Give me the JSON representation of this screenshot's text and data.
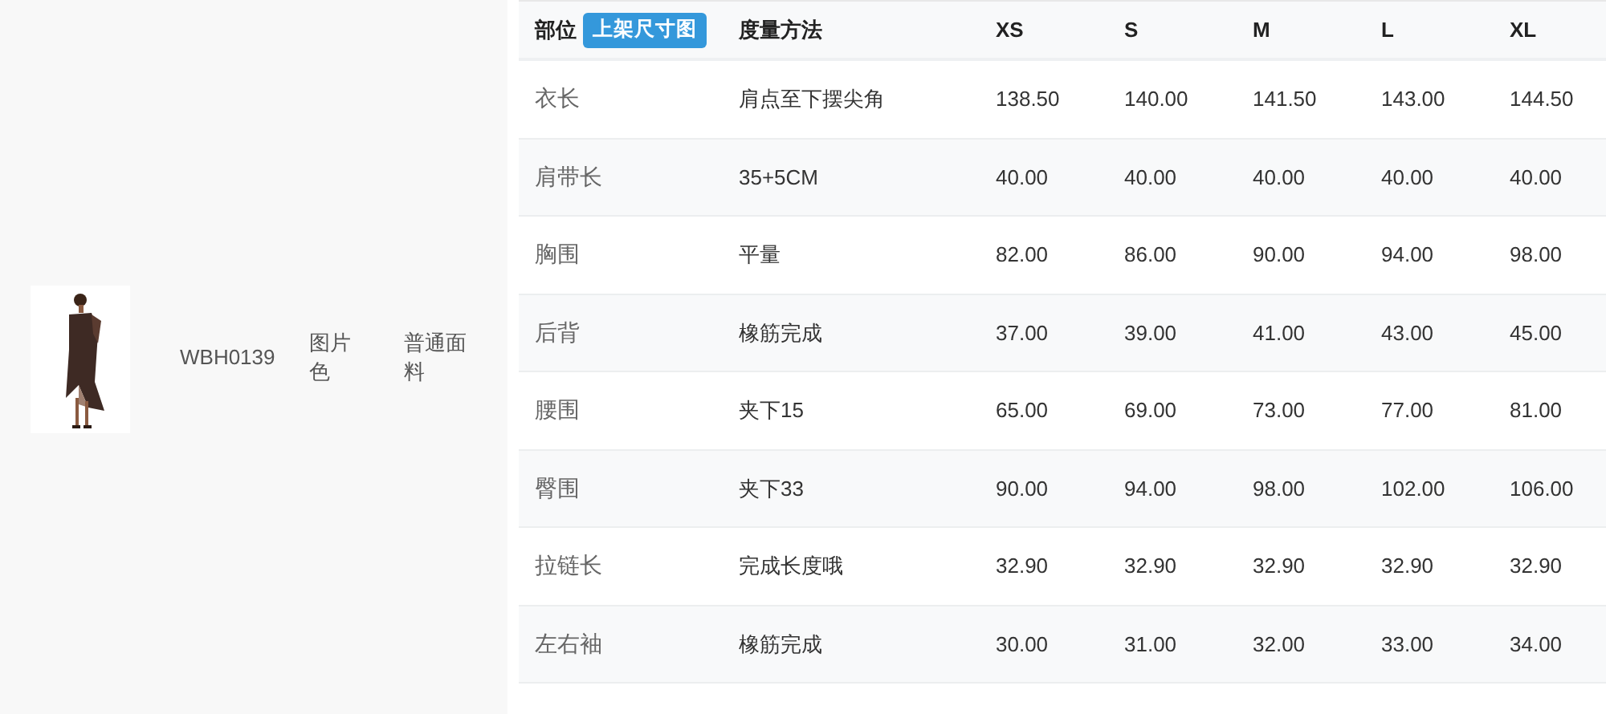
{
  "product": {
    "code": "WBH0139",
    "color_label": "图片色",
    "fabric": "普通面料"
  },
  "size_table": {
    "part_header": "部位",
    "size_chart_button": "上架尺寸图",
    "method_header": "度量方法",
    "sizes": [
      "XS",
      "S",
      "M",
      "L",
      "XL"
    ],
    "rows": [
      {
        "part": "衣长",
        "method": "肩点至下摆尖角",
        "values": [
          "138.50",
          "140.00",
          "141.50",
          "143.00",
          "144.50"
        ]
      },
      {
        "part": "肩带长",
        "method": "35+5CM",
        "values": [
          "40.00",
          "40.00",
          "40.00",
          "40.00",
          "40.00"
        ]
      },
      {
        "part": "胸围",
        "method": "平量",
        "values": [
          "82.00",
          "86.00",
          "90.00",
          "94.00",
          "98.00"
        ]
      },
      {
        "part": "后背",
        "method": "橡筋完成",
        "values": [
          "37.00",
          "39.00",
          "41.00",
          "43.00",
          "45.00"
        ]
      },
      {
        "part": "腰围",
        "method": "夹下15",
        "values": [
          "65.00",
          "69.00",
          "73.00",
          "77.00",
          "81.00"
        ]
      },
      {
        "part": "臀围",
        "method": "夹下33",
        "values": [
          "90.00",
          "94.00",
          "98.00",
          "102.00",
          "106.00"
        ]
      },
      {
        "part": "拉链长",
        "method": "完成长度哦",
        "values": [
          "32.90",
          "32.90",
          "32.90",
          "32.90",
          "32.90"
        ]
      },
      {
        "part": "左右袖",
        "method": "橡筋完成",
        "values": [
          "30.00",
          "31.00",
          "32.00",
          "33.00",
          "34.00"
        ]
      }
    ]
  }
}
